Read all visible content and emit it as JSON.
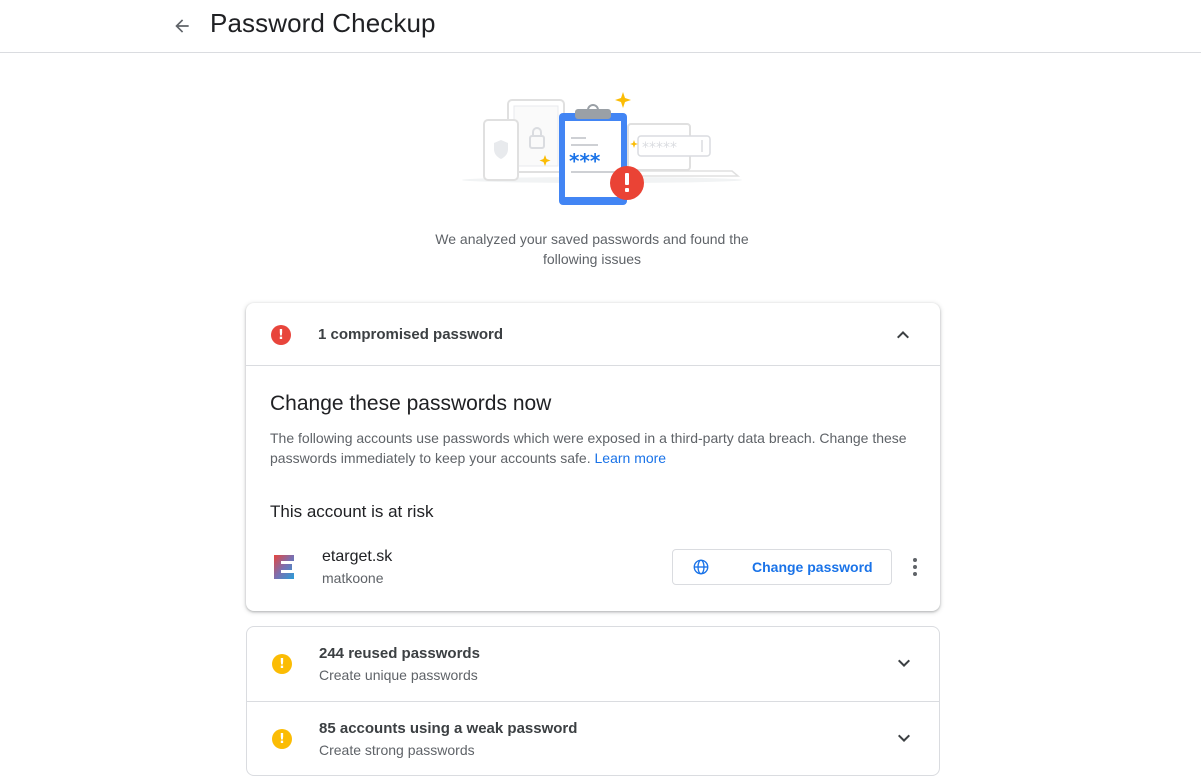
{
  "header": {
    "title": "Password Checkup",
    "back_icon": "arrow-back-icon"
  },
  "summary": {
    "line1": "We analyzed your saved passwords and found the",
    "line2": "following issues"
  },
  "compromised": {
    "title": "1 compromised password",
    "icon": "error-icon",
    "color": "#e8453c",
    "heading": "Change these passwords now",
    "description": "The following accounts use passwords which were exposed in a third-party data breach. Change these passwords immediately to keep your accounts safe.",
    "learn_more": "Learn more",
    "risk_heading": "This account is at risk",
    "account": {
      "site": "etarget.sk",
      "username": "matkoone",
      "change_button": "Change password"
    }
  },
  "reused": {
    "title": "244 reused passwords",
    "subtitle": "Create unique passwords",
    "icon": "warning-icon",
    "color": "#fbbc04"
  },
  "weak": {
    "title": "85 accounts using a weak password",
    "subtitle": "Create strong passwords",
    "icon": "warning-icon",
    "color": "#fbbc04"
  },
  "colors": {
    "link": "#1a73e8",
    "primary_blue": "#4285f4"
  }
}
